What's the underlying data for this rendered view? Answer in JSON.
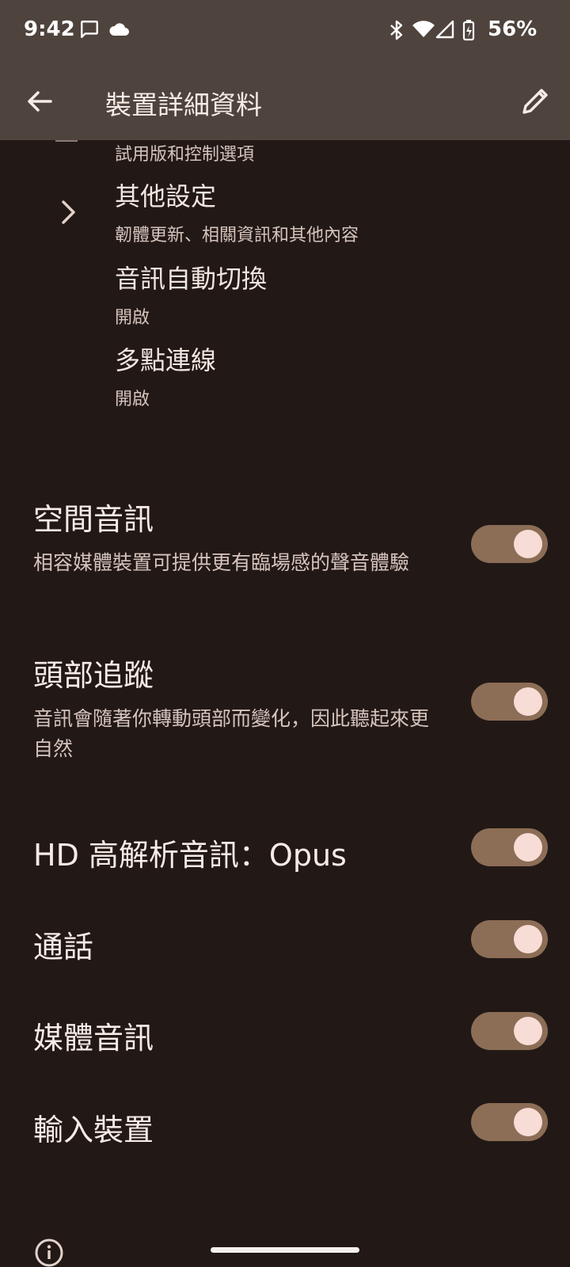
{
  "status_bar": {
    "time": "9:42",
    "battery": "56%",
    "icons": [
      "message-icon",
      "cloud-icon",
      "bluetooth-icon",
      "wifi-icon",
      "signal-icon",
      "battery-icon"
    ]
  },
  "app_bar": {
    "title": "裝置詳細資料",
    "back_icon": "arrow-back-icon",
    "edit_icon": "edit-pencil-icon"
  },
  "device_items": [
    {
      "summary": "試用版和控制選項"
    },
    {
      "title": "其他設定",
      "summary": "韌體更新、相關資訊和其他內容",
      "icon": "chevron-right-icon"
    },
    {
      "title": "音訊自動切換",
      "summary": "開啟"
    },
    {
      "title": "多點連線",
      "summary": "開啟"
    }
  ],
  "settings": [
    {
      "title": "空間音訊",
      "summary": "相容媒體裝置可提供更有臨場感的聲音體驗",
      "enabled": true
    },
    {
      "title": "頭部追蹤",
      "summary": "音訊會隨著你轉動頭部而變化，因此聽起來更自然",
      "enabled": true
    },
    {
      "title": "HD 高解析音訊：Opus",
      "enabled": true
    },
    {
      "title": "通話",
      "enabled": true
    },
    {
      "title": "媒體音訊",
      "enabled": true
    },
    {
      "title": "輸入裝置",
      "enabled": true
    }
  ],
  "colors": {
    "background": "#221916",
    "header": "#4f433d",
    "toggle_track": "#8c6d56",
    "toggle_thumb": "#f8dcd6"
  }
}
